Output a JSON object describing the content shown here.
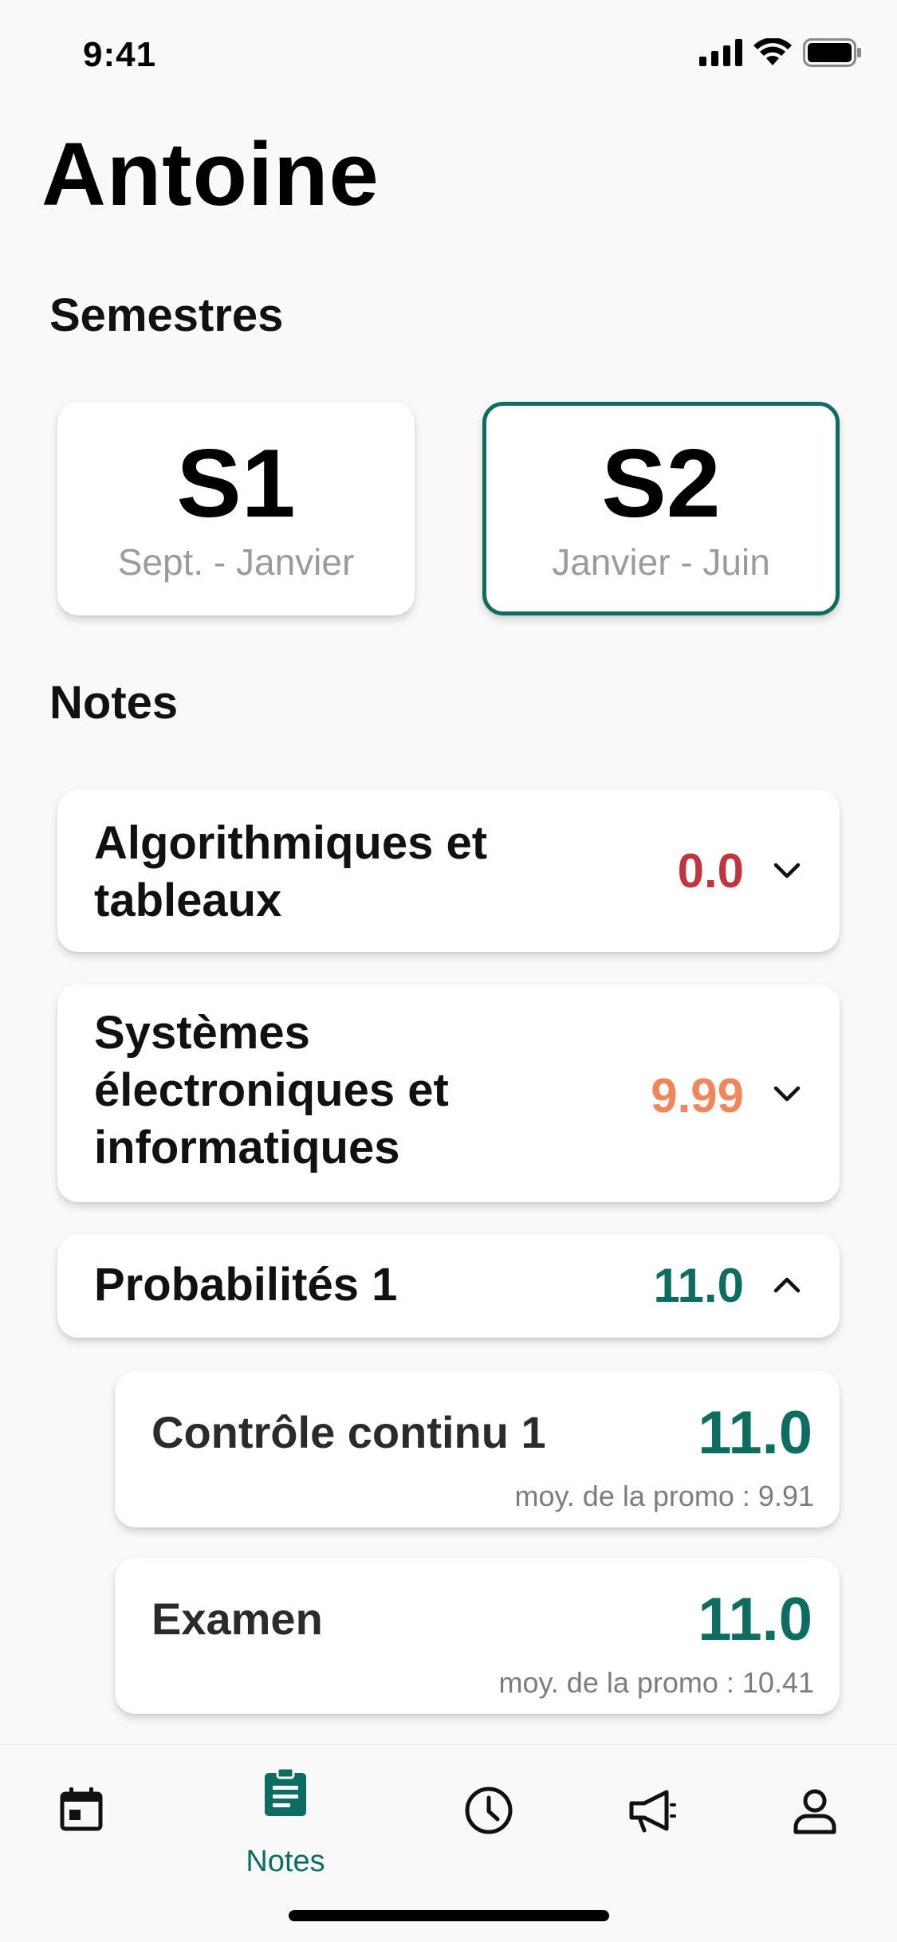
{
  "status_bar": {
    "time": "9:41"
  },
  "page": {
    "title": "Antoine"
  },
  "semesters": {
    "label": "Semestres",
    "items": [
      {
        "code": "S1",
        "range": "Sept. - Janvier",
        "selected": false
      },
      {
        "code": "S2",
        "range": "Janvier - Juin",
        "selected": true
      }
    ]
  },
  "notes": {
    "label": "Notes",
    "subjects": [
      {
        "name": "Algorithmiques et tableaux",
        "grade": "0.0",
        "grade_color": "#c0353f",
        "expanded": false
      },
      {
        "name": "Systèmes électroniques et informatiques",
        "grade": "9.99",
        "grade_color": "#f0875a",
        "expanded": false
      },
      {
        "name": "Probabilités 1",
        "grade": "11.0",
        "grade_color": "#0d6d61",
        "expanded": true
      }
    ],
    "evaluations": [
      {
        "name": "Contrôle continu 1",
        "grade": "11.0",
        "average": "moy. de la promo : 9.91"
      },
      {
        "name": "Examen",
        "grade": "11.0",
        "average": "moy. de la promo : 10.41"
      }
    ]
  },
  "tabbar": {
    "accent": "#0d6d61",
    "tabs": [
      {
        "icon": "calendar-icon",
        "label": "",
        "active": false
      },
      {
        "icon": "clipboard-icon",
        "label": "Notes",
        "active": true
      },
      {
        "icon": "clock-icon",
        "label": "",
        "active": false
      },
      {
        "icon": "megaphone-icon",
        "label": "",
        "active": false
      },
      {
        "icon": "person-icon",
        "label": "",
        "active": false
      }
    ]
  }
}
